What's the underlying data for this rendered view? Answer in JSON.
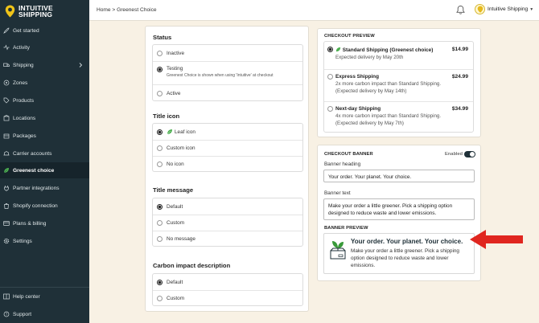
{
  "app": {
    "logo_line1": "INTUITIVE",
    "logo_line2": "SHIPPING"
  },
  "sidebar": {
    "items": [
      {
        "label": "Get started",
        "icon": "rocket-icon"
      },
      {
        "label": "Activity",
        "icon": "activity-icon"
      },
      {
        "label": "Shipping",
        "icon": "truck-icon"
      },
      {
        "label": "Zones",
        "icon": "zones-icon"
      },
      {
        "label": "Products",
        "icon": "tag-icon"
      },
      {
        "label": "Locations",
        "icon": "location-icon"
      },
      {
        "label": "Packages",
        "icon": "package-icon"
      },
      {
        "label": "Carrier accounts",
        "icon": "carrier-icon"
      },
      {
        "label": "Greenest choice",
        "icon": "leaf-icon"
      },
      {
        "label": "Partner integrations",
        "icon": "plug-icon"
      },
      {
        "label": "Shopify connection",
        "icon": "shopify-icon"
      },
      {
        "label": "Plans & billing",
        "icon": "billing-icon"
      },
      {
        "label": "Settings",
        "icon": "gear-icon"
      }
    ],
    "bottom": [
      {
        "label": "Help center",
        "icon": "help-icon"
      },
      {
        "label": "Support",
        "icon": "support-icon"
      }
    ]
  },
  "topbar": {
    "breadcrumb": "Home > Greenest Choice",
    "account_name": "Intuitive Shipping"
  },
  "status": {
    "title": "Status",
    "options": [
      "Inactive",
      "Testing",
      "Active"
    ],
    "selected": "Testing",
    "testing_note": "Greenest Choice is shown when using 'Intuitive' at checkout"
  },
  "title_icon": {
    "title": "Title icon",
    "options": [
      "Leaf icon",
      "Custom icon",
      "No icon"
    ],
    "selected": "Leaf icon"
  },
  "title_message": {
    "title": "Title message",
    "options": [
      "Default",
      "Custom",
      "No message"
    ],
    "selected": "Default"
  },
  "carbon": {
    "title": "Carbon impact description",
    "options": [
      "Default",
      "Custom"
    ],
    "selected": "Default"
  },
  "checkout_preview": {
    "title": "CHECKOUT PREVIEW",
    "options": [
      {
        "name": "Standard Shipping (Greenest choice)",
        "price": "$14.99",
        "desc1": "Expected delivery by May 20th",
        "desc2": ""
      },
      {
        "name": "Express Shipping",
        "price": "$24.99",
        "desc1": "2x more carbon impact than Standard Shipping.",
        "desc2": "(Expected delivery by May 14th)"
      },
      {
        "name": "Next-day Shipping",
        "price": "$34.99",
        "desc1": "4x more carbon impact than Standard Shipping.",
        "desc2": "(Expected delivery by May 7th)"
      }
    ]
  },
  "checkout_banner": {
    "title": "CHECKOUT BANNER",
    "enabled_label": "Enabled",
    "enabled": true,
    "heading_label": "Banner heading",
    "heading_value": "Your order. Your planet. Your choice.",
    "text_label": "Banner text",
    "text_value": "Make your order a little greener. Pick a shipping option designed to reduce waste and lower emissions.",
    "preview_title": "BANNER PREVIEW",
    "preview_heading": "Your order. Your planet. Your choice.",
    "preview_text": "Make your order a little greener. Pick a shipping option designed to reduce waste and lower emissions."
  },
  "colors": {
    "sidebar": "#1f3038",
    "background": "#f8f1e4",
    "accent_green": "#3a9a3a",
    "arrow": "#e0261f"
  }
}
